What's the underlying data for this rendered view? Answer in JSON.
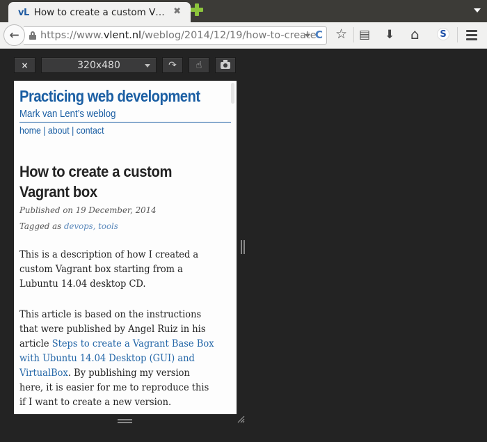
{
  "browser": {
    "tab": {
      "favicon_text": "vL",
      "title": "How to create a custom V…",
      "close_glyph": "✖"
    },
    "url": {
      "prefix": "https://www.",
      "domain": "vlent.nl",
      "path": "/weblog/2014/12/19/how-to-create"
    },
    "icons": {
      "back": "🡐",
      "reload": "C",
      "bookmark_star": "☆",
      "reading_list": "▤",
      "download": "⬇",
      "home": "⌂",
      "s_badge": "S"
    }
  },
  "responsive_toolbar": {
    "close_glyph": "×",
    "size_preset": "320x480",
    "rotate_glyph": "↷",
    "touch_glyph": "☝"
  },
  "page": {
    "site_title": "Practicing web development",
    "site_subtitle": "Mark van Lent’s weblog",
    "nav": [
      {
        "label": "home"
      },
      {
        "label": "about"
      },
      {
        "label": "contact"
      }
    ],
    "nav_separator": " | ",
    "post": {
      "title_lines": [
        "How to create a custom",
        "Vagrant box"
      ],
      "published": "Published on 19 December, 2014",
      "tagged_prefix": "Tagged as ",
      "tags": [
        "devops",
        "tools"
      ],
      "tag_separator": ", ",
      "paragraph1_lines": [
        "This is a description of how I created a",
        "custom Vagrant box starting from a",
        "Lubuntu 14.04 desktop CD."
      ],
      "paragraph2": {
        "line1": "This article is based on the instructions",
        "line2": "that were published by Angel Ruiz in his",
        "line3_text": "article ",
        "link_line1": "Steps to create a Vagrant Base Box",
        "link_line2": "with Ubuntu 14.04 Desktop (GUI) and",
        "link_line3": "VirtualBox",
        "line5_rest": ". By publishing my version",
        "line6": "here, it is easier for me to reproduce this",
        "line7": "if I want to create a new version."
      }
    }
  },
  "colors": {
    "link_blue": "#1a5ea3",
    "tag_blue": "#5a88bb",
    "new_tab_green": "#8cc43c",
    "chrome_dark": "#232323"
  }
}
